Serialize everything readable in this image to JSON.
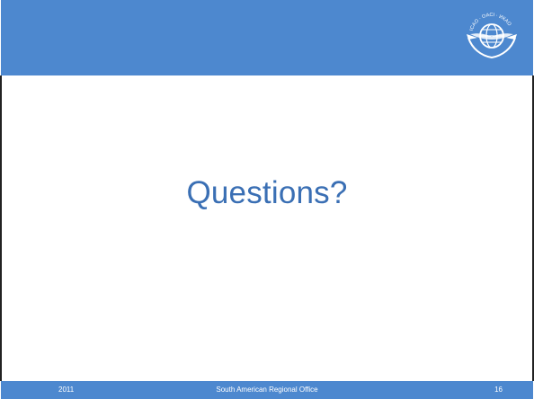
{
  "slide": {
    "title": "Questions?",
    "logo_icon": "icao-emblem-icon",
    "logo_text": "ICAO · OACI · ИКАО",
    "header_color": "#4d88cf",
    "title_color": "#3a6fb4"
  },
  "footer": {
    "year": "2011",
    "office": "South American Regional Office",
    "page_number": "16"
  }
}
